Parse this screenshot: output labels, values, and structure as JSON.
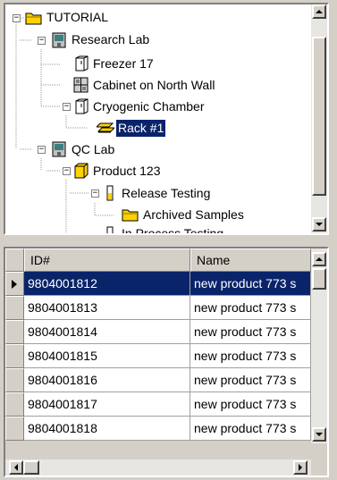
{
  "tree": {
    "nodes": [
      {
        "label": "TUTORIAL",
        "icon": "folder-open-icon"
      },
      {
        "label": "Research Lab",
        "icon": "lab-building-icon"
      },
      {
        "label": "Freezer 17",
        "icon": "freezer-icon"
      },
      {
        "label": "Cabinet on North Wall",
        "icon": "cabinet-icon"
      },
      {
        "label": "Cryogenic Chamber",
        "icon": "chamber-icon"
      },
      {
        "label": "Rack #1",
        "icon": "rack-icon"
      },
      {
        "label": "QC Lab",
        "icon": "lab-building-icon"
      },
      {
        "label": "Product 123",
        "icon": "product-box-icon"
      },
      {
        "label": "Release Testing",
        "icon": "test-tube-icon"
      },
      {
        "label": "Archived Samples",
        "icon": "folder-open-icon"
      },
      {
        "label": "In Process Testing",
        "icon": "test-tube-icon"
      }
    ],
    "expanders": {
      "expanded": "−"
    }
  },
  "grid": {
    "columns": [
      "ID#",
      "Name"
    ],
    "rows": [
      {
        "id": "9804001812",
        "name": "new product 773 s"
      },
      {
        "id": "9804001813",
        "name": "new product 773 s"
      },
      {
        "id": "9804001814",
        "name": "new product 773 s"
      },
      {
        "id": "9804001815",
        "name": "new product 773 s"
      },
      {
        "id": "9804001816",
        "name": "new product 773 s"
      },
      {
        "id": "9804001817",
        "name": "new product 773 s"
      },
      {
        "id": "9804001818",
        "name": "new product 773 s"
      }
    ]
  },
  "colors": {
    "selection": "#0a246a",
    "window": "#d4d0c8",
    "folder": "#ffd200"
  }
}
